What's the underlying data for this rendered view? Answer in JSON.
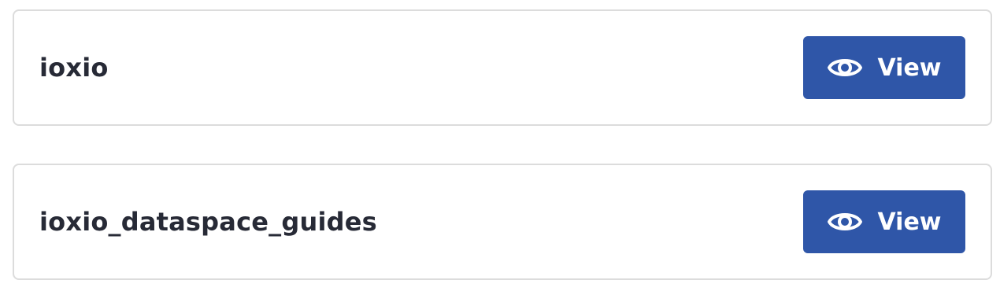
{
  "colors": {
    "button_bg": "#2f56a8",
    "title_text": "#272a36",
    "card_border": "#dcdcdc"
  },
  "items": [
    {
      "name": "ioxio",
      "button_label": "View",
      "button_icon": "eye-icon"
    },
    {
      "name": "ioxio_dataspace_guides",
      "button_label": "View",
      "button_icon": "eye-icon"
    }
  ]
}
